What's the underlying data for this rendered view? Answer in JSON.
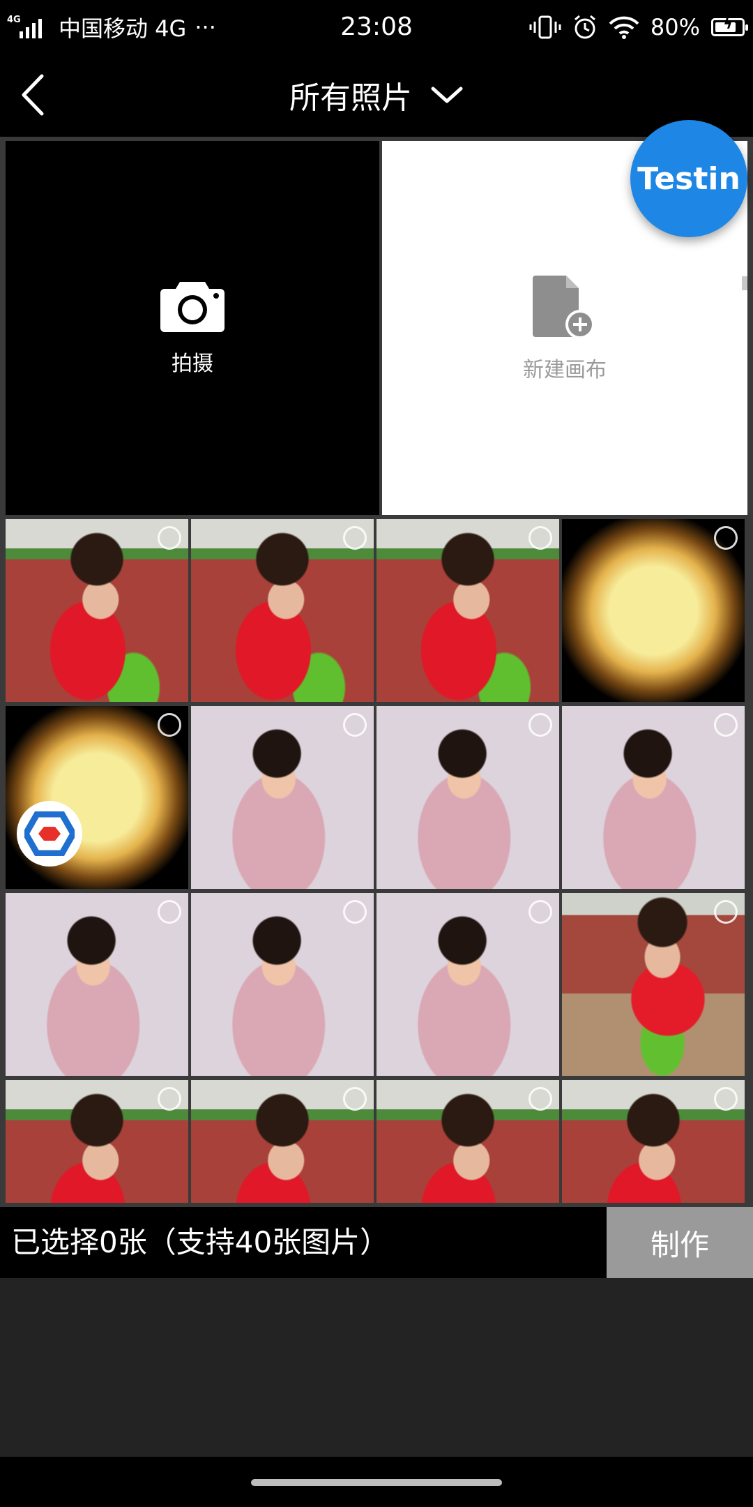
{
  "status_bar": {
    "network_tag": "4G",
    "carrier": "中国移动 4G",
    "more": "···",
    "time": "23:08",
    "battery_level": 80,
    "battery_text": "80%"
  },
  "header": {
    "title": "所有照片"
  },
  "tiles": {
    "camera_label": "拍摄",
    "canvas_label": "新建画布"
  },
  "overlay": {
    "badge_text": "Testin"
  },
  "grid": {
    "thumbnails": [
      {
        "scene": "red"
      },
      {
        "scene": "red"
      },
      {
        "scene": "red"
      },
      {
        "scene": "bokeh"
      },
      {
        "scene": "bokeh"
      },
      {
        "scene": "pink"
      },
      {
        "scene": "pink"
      },
      {
        "scene": "pink"
      },
      {
        "scene": "pink"
      },
      {
        "scene": "pink"
      },
      {
        "scene": "pink"
      },
      {
        "scene": "red2"
      },
      {
        "scene": "red"
      },
      {
        "scene": "red"
      },
      {
        "scene": "red"
      },
      {
        "scene": "red"
      }
    ]
  },
  "footer": {
    "selection_text": "已选择0张（支持40张图片）",
    "make_label": "制作"
  },
  "colors": {
    "badge_blue": "#1e87e5",
    "button_gray": "#9a9a9a",
    "background": "#000000"
  }
}
